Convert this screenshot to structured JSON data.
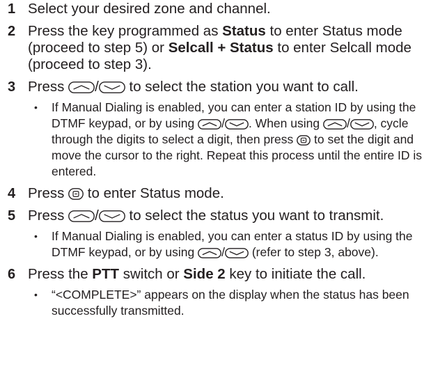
{
  "steps": [
    {
      "number": "1",
      "text": "Select your desired zone and channel."
    },
    {
      "number": "2",
      "t1": "Press the key programmed as ",
      "b1": "Status",
      "t2": " to enter Status mode (proceed to step 5) or ",
      "b2": "Selcall + Status",
      "t3": " to enter Selcall mode (proceed to step 3)."
    },
    {
      "number": "3",
      "t1": "Press ",
      "t2": " to select the station you want to call.",
      "bullet": {
        "t1": "If Manual Dialing is enabled, you can enter a station ID by using the DTMF keypad, or by using ",
        "t2": ".  When using ",
        "t3": ", cycle through the digits to select a digit, then press ",
        "t4": " to set the digit and move the cursor to the right.  Repeat this process until the entire ID is entered."
      }
    },
    {
      "number": "4",
      "t1": "Press ",
      "t2": " to enter Status mode."
    },
    {
      "number": "5",
      "t1": "Press ",
      "t2": " to select the status you want to transmit.",
      "bullet": {
        "t1": "If Manual Dialing is enabled, you can enter a status ID by using the DTMF keypad, or by using ",
        "t2": " (refer to step 3, above)."
      }
    },
    {
      "number": "6",
      "t1": "Press the ",
      "b1": "PTT",
      "t2": " switch or ",
      "b2": "Side 2",
      "t3": " key to initiate the call.",
      "bullet": {
        "text": "“<COMPLETE>” appears on the display when the status has been successfully transmitted."
      }
    }
  ],
  "icons": {
    "up_down_key": "up-down-key-icon",
    "enter_key": "enter-key-icon",
    "separator": "/"
  }
}
